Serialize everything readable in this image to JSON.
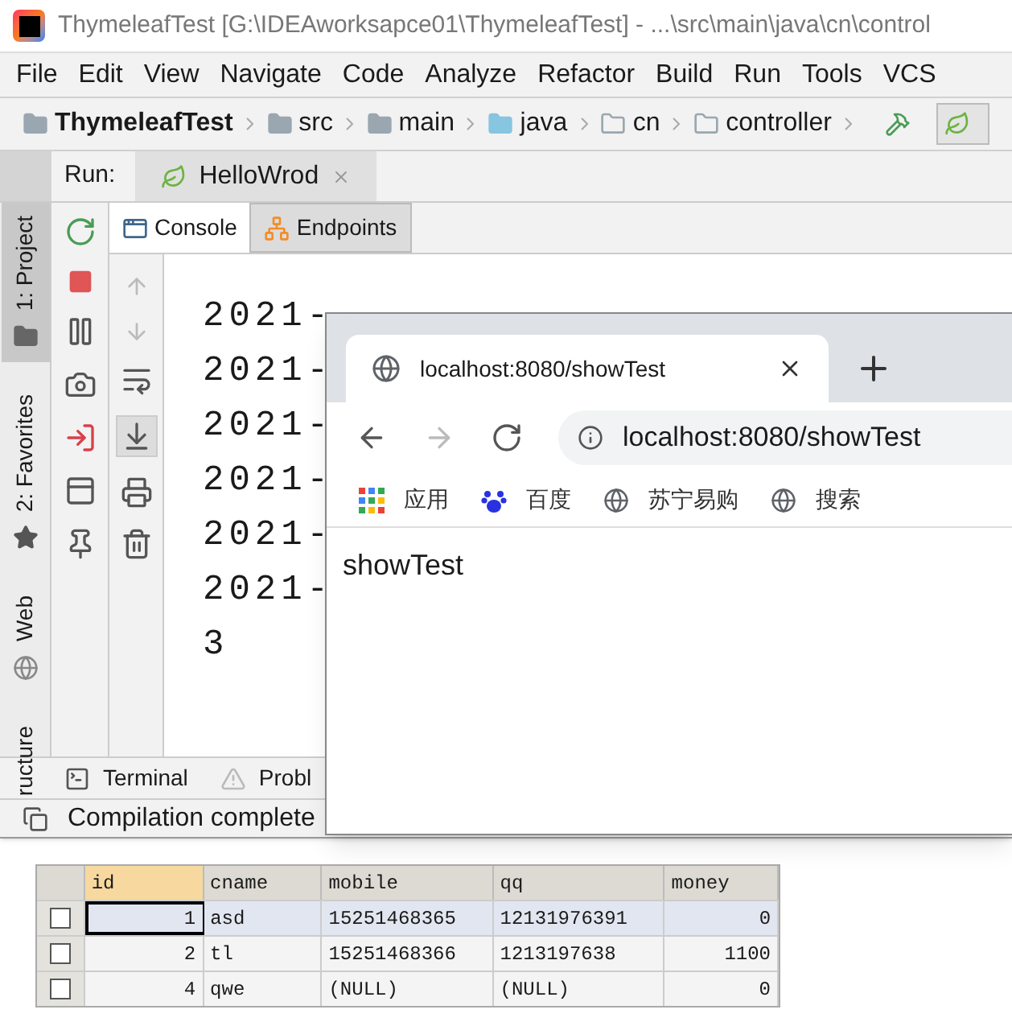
{
  "window": {
    "title": "ThymeleafTest [G:\\IDEAworksapce01\\ThymeleafTest] - ...\\src\\main\\java\\cn\\control"
  },
  "menu": [
    "File",
    "Edit",
    "View",
    "Navigate",
    "Code",
    "Analyze",
    "Refactor",
    "Build",
    "Run",
    "Tools",
    "VCS"
  ],
  "breadcrumb": [
    {
      "label": "ThymeleafTest",
      "kind": "project"
    },
    {
      "label": "src",
      "kind": "folder"
    },
    {
      "label": "main",
      "kind": "folder"
    },
    {
      "label": "java",
      "kind": "source"
    },
    {
      "label": "cn",
      "kind": "package"
    },
    {
      "label": "controller",
      "kind": "package"
    }
  ],
  "run_bar": {
    "label": "Run:",
    "tab": "HelloWrod"
  },
  "side_tabs": [
    {
      "label": "1: Project",
      "selected": true
    },
    {
      "label": "2: Favorites",
      "selected": false
    },
    {
      "label": "Web",
      "selected": false
    },
    {
      "label": "ructure",
      "selected": false
    }
  ],
  "console_tabs": [
    {
      "label": "Console",
      "selected": true
    },
    {
      "label": "Endpoints",
      "selected": false
    }
  ],
  "console_lines": [
    "2021-",
    "2021-",
    "2021-",
    "2021-",
    "2021-",
    "2021-",
    "3"
  ],
  "tool_tabs": [
    {
      "label": "Terminal",
      "kind": "terminal"
    },
    {
      "label": "Probl",
      "kind": "problems"
    }
  ],
  "status_bar": "Compilation complete",
  "browser": {
    "tab_title": "localhost:8080/showTest",
    "address": "localhost:8080/showTest",
    "bookmarks": [
      {
        "label": "应用",
        "kind": "apps"
      },
      {
        "label": "百度",
        "kind": "paw"
      },
      {
        "label": "苏宁易购",
        "kind": "globe"
      },
      {
        "label": "搜索",
        "kind": "globe"
      }
    ],
    "content": "showTest"
  },
  "table": {
    "columns": [
      "id",
      "cname",
      "mobile",
      "qq",
      "money"
    ],
    "rows": [
      {
        "selected": true,
        "cells": [
          "1",
          "asd",
          "15251468365",
          "12131976391",
          "0"
        ]
      },
      {
        "selected": false,
        "cells": [
          "2",
          "tl",
          "15251468366",
          "1213197638",
          "1100"
        ]
      },
      {
        "selected": false,
        "cells": [
          "4",
          "qwe",
          "(NULL)",
          "(NULL)",
          "0"
        ]
      }
    ]
  }
}
